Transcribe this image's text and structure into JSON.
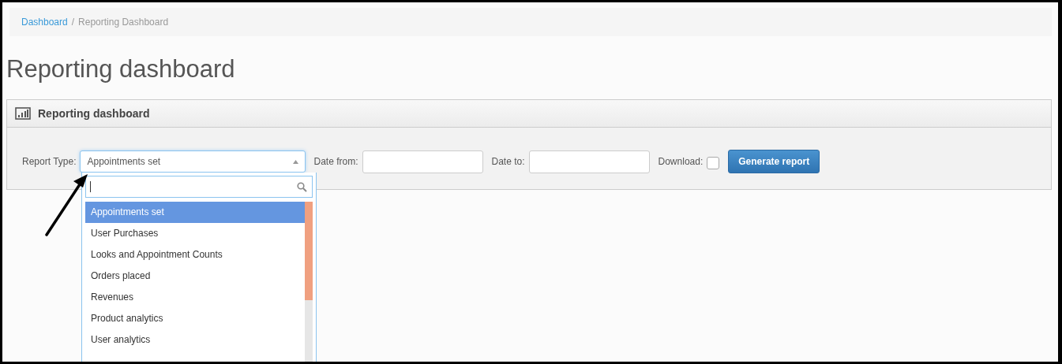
{
  "breadcrumb_separator": "/",
  "breadcrumb": [
    {
      "label": "Dashboard",
      "link": true
    },
    {
      "label": "Reporting Dashboard",
      "link": false
    }
  ],
  "page_title": "Reporting dashboard",
  "panel": {
    "title": "Reporting dashboard"
  },
  "form": {
    "report_type_label": "Report Type:",
    "report_type_value": "Appointments set",
    "date_from_label": "Date from:",
    "date_to_label": "Date to:",
    "download_label": "Download:",
    "download_checked": false,
    "button": "Generate report"
  },
  "dropdown": {
    "options": [
      {
        "label": "Appointments set",
        "selected": true
      },
      {
        "label": "User Purchases",
        "selected": false
      },
      {
        "label": "Looks and Appointment Counts",
        "selected": false
      },
      {
        "label": "Orders placed",
        "selected": false
      },
      {
        "label": "Revenues",
        "selected": false
      },
      {
        "label": "Product analytics",
        "selected": false
      },
      {
        "label": "User analytics",
        "selected": false
      }
    ]
  }
}
